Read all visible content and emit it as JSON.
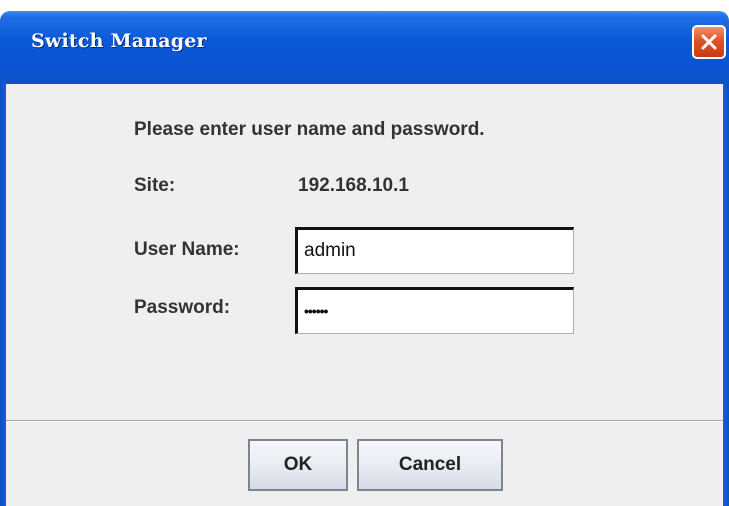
{
  "window": {
    "title": "Switch Manager",
    "titlebar_color": "#0a54d2",
    "close_button_color": "#e0542a",
    "close_icon": "close-icon"
  },
  "dialog": {
    "prompt": "Please enter user name and password.",
    "site_label": "Site:",
    "site_value": "192.168.10.1",
    "user_name_label": "User Name:",
    "user_name_value": "admin",
    "password_label": "Password:",
    "password_mask": "••••••"
  },
  "buttons": {
    "ok_label": "OK",
    "cancel_label": "Cancel"
  }
}
